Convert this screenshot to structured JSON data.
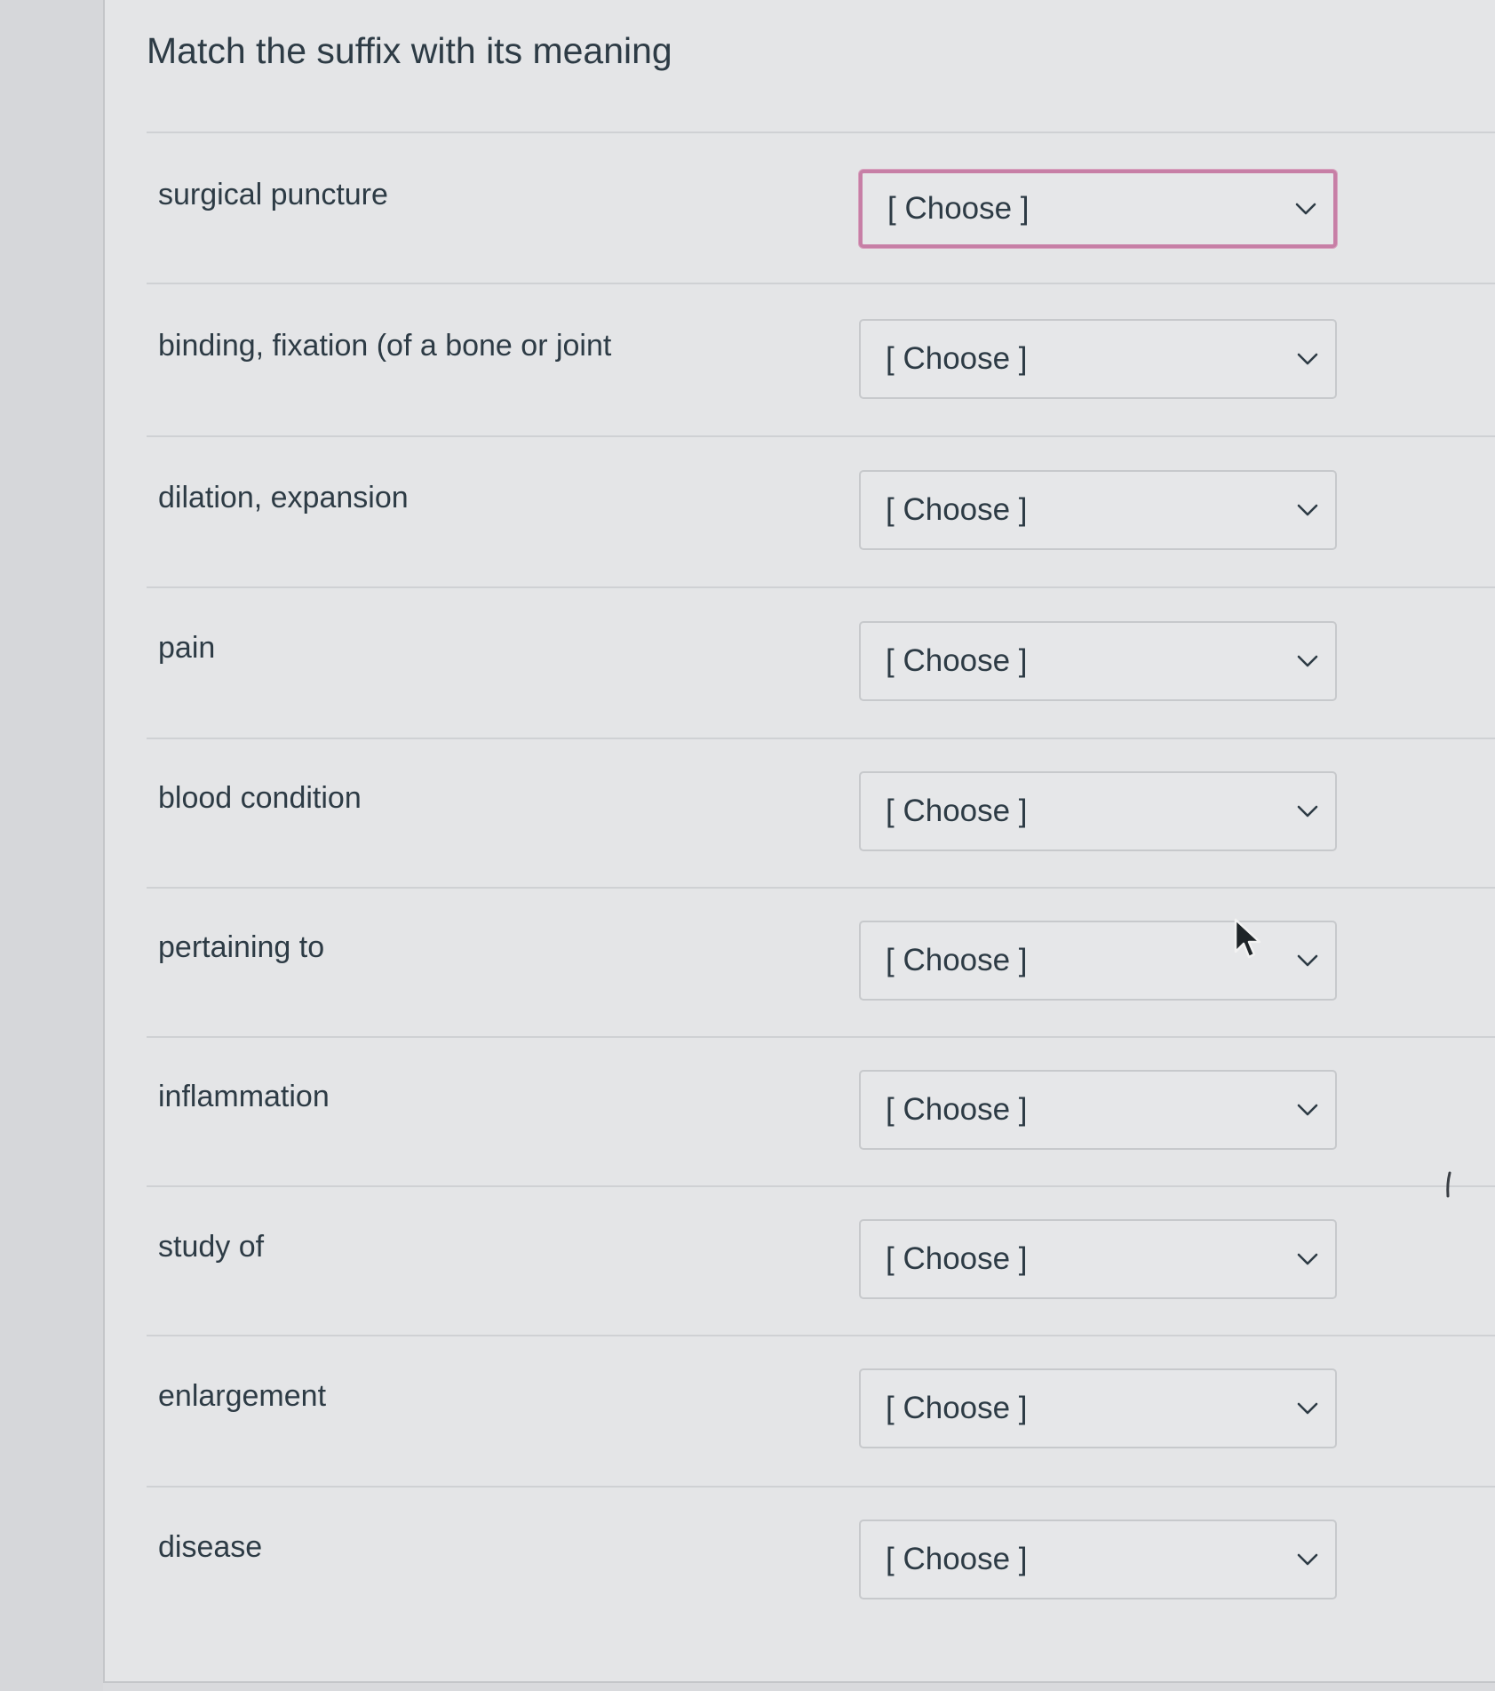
{
  "question": {
    "title": "Match the suffix with its meaning"
  },
  "rows": [
    {
      "label": "surgical puncture",
      "select_value": "[ Choose ]",
      "focused": true
    },
    {
      "label": "binding, fixation (of a bone or joint",
      "select_value": "[ Choose ]"
    },
    {
      "label": "dilation, expansion",
      "select_value": "[ Choose ]"
    },
    {
      "label": "pain",
      "select_value": "[ Choose ]"
    },
    {
      "label": "blood condition",
      "select_value": "[ Choose ]"
    },
    {
      "label": "pertaining to",
      "select_value": "[ Choose ]"
    },
    {
      "label": "inflammation",
      "select_value": "[ Choose ]"
    },
    {
      "label": "study of",
      "select_value": "[ Choose ]"
    },
    {
      "label": "enlargement",
      "select_value": "[ Choose ]"
    },
    {
      "label": "disease",
      "select_value": "[ Choose ]"
    }
  ],
  "icons": {
    "dropdown": "chevron-down-icon",
    "pointer": "mouse-cursor-icon"
  },
  "colors": {
    "text": "#2d3b45",
    "focus_border": "#c77fa6",
    "select_border": "#c7c9cc",
    "panel_background": "#e4e5e7"
  }
}
